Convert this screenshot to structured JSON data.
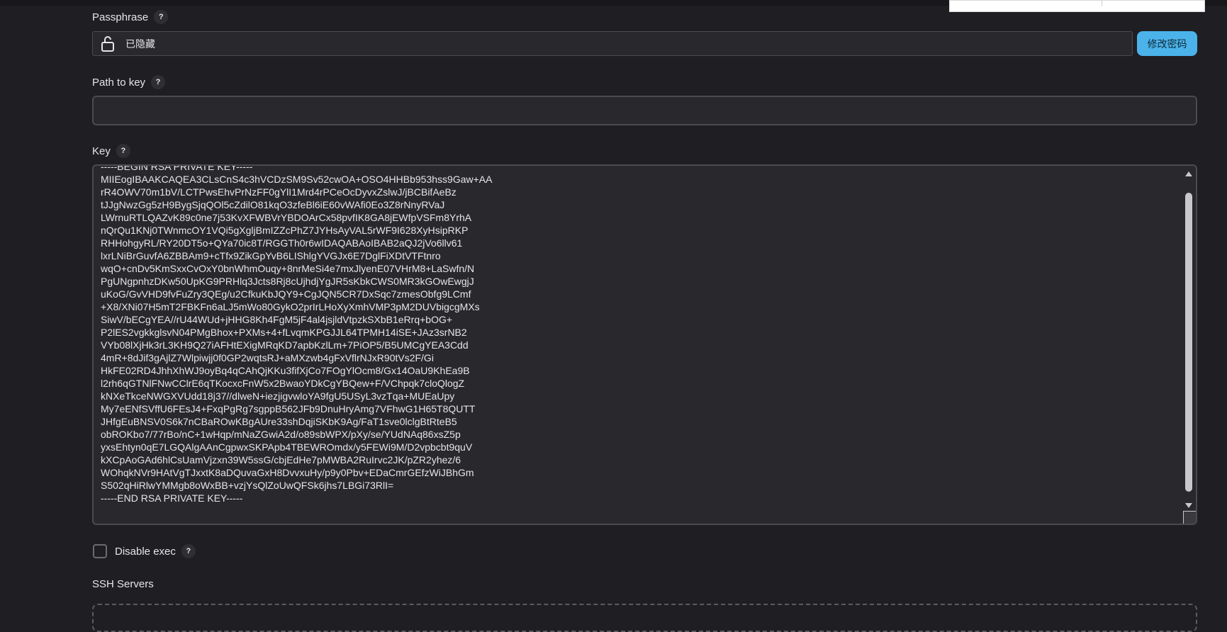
{
  "passphrase": {
    "label": "Passphrase",
    "help": "?",
    "value": "已隐藏",
    "change_button": "修改密码"
  },
  "path_to_key": {
    "label": "Path to key",
    "help": "?",
    "value": ""
  },
  "key": {
    "label": "Key",
    "help": "?",
    "text": "-----BEGIN RSA PRIVATE KEY-----\nMIIEogIBAAKCAQEA3CLsCnS4c3hVCDzSM9Sv52cwOA+OSO4HHBb953hss9Gaw+AA\nrR4OWV70m1bV/LCTPwsEhvPrNzFF0gYlI1Mrd4rPCeOcDyvxZslwJ/jBCBifAeBz\ntJJgNwzGg5zH9BygSjqQOl5cZdilO81kqO3zfeBl6iE60vWAfi0Eo3Z8rNnyRVaJ\nLWrnuRTLQAZvK89c0ne7j53KvXFWBVrYBDOArCx58pvfIK8GA8jEWfpVSFm8YrhA\nnQrQu1KNj0TWnmcOY1VQi5gXgljBmIZZcPhZ7JYHsAyVAL5rWF9I628XyHsipRKP\nRHHohgyRL/RY20DT5o+QYa70ic8T/RGGTh0r6wIDAQABAoIBAB2aQJ2jVo6llv61\nlxrLNiBrGuvfA6ZBBAm9+cTfx9ZikGpYvB6LIShlgYVGJx6E7DglFiXDtVTFtnro\nwqO+cnDv5KmSxxCvOxY0bnWhmOuqy+8nrMeSi4e7mxJlyenE07VHrM8+LaSwfn/N\nPgUNgpnhzDKw50UpKG9PRHlq3Jcts8Rj8cUjhdjYgJR5sKbkCWS0MR3kGOwEwgjJ\nuKoG/GvVHD9fvFuZry3QEg/u2CfkuKbJQY9+CgJQN5CR7DxSqc7zmesObfg9LCmf\n+X8/XNi07H5mT2FBKFn6aLJ5mWo80GykO2prIrLHoXyXmhVMP3pM2DUVbigcgMXs\nSiwV/bECgYEA//rU44WUd+jHHG8Kh4FgM5jF4al4jsjldVtpzkSXbB1eRrq+bOG+\nP2lES2vgkkglsvN04PMgBhox+PXMs+4+fLvqmKPGJJL64TPMH14iSE+JAz3srNB2\nVYb08lXjHk3rL3KH9Q27iAFHtEXigMRqKD7apbKzlLm+7PiOP5/B5UMCgYEA3Cdd\n4mR+8dJif3gAjlZ7Wlpiwjj0f0GP2wqtsRJ+aMXzwb4gFxVflrNJxR90tVs2F/Gi\nHkFE02RD4JhhXhWJ9oyBq4qCAhQjKKu3fifXjCo7FOgYlOcm8/Gx14OaU9KhEa9B\nl2rh6qGTNlFNwCClrE6qTKocxcFnW5x2BwaoYDkCgYBQew+F/VChpqk7cloQlogZ\nkNXeTkceNWGXVUdd18j37//dlweN+iezjigvwloYA9fgU5USyL3vzTqa+MUEaUpy\nMy7eENfSVffU6FEsJ4+FxqPgRg7sgppB562JFb9DnuHryAmg7VFhwG1H65T8QUTT\nJHfgEuBNSV0S6k7nCBaROwKBgAUre33shDqjiSKbK9Ag/FaT1sve0lclgBtRteB5\nobROKbo7/77rBo/nC+1wHqp/mNaZGwiA2d/o89sbWPX/pXy/se/YUdNAq86xsZ5p\nyxsEhtyn0qE7LGQAlgAAnCgpwxSKPApb4TBEWROmdx/y5FEWi9M/D2vpbcbt9quV\nkXCpAoGAd6hlCsUamVjzxn39W5ssG/cbjEdHe7pMWBA2RuIrvc2JK/pZR2yhez/6\nWOhqkNVr9HAtVgTJxxtK8aDQuvaGxH8DvvxuHy/p9y0Pbv+EDaCmrGEfzWiJBhGm\nS502qHiRlwYMMgb8oWxBB+vzjYsQlZoUwQFSk6jhs7LBGi73RlI=\n-----END RSA PRIVATE KEY-----"
  },
  "disable_exec": {
    "label": "Disable exec",
    "help": "?",
    "checked": false
  },
  "ssh_servers": {
    "label": "SSH Servers"
  },
  "icons": {
    "lock": "lock-icon",
    "help": "help-icon"
  },
  "colors": {
    "background": "#1f1f23",
    "field": "#29292d",
    "accent": "#4bb3ea"
  }
}
